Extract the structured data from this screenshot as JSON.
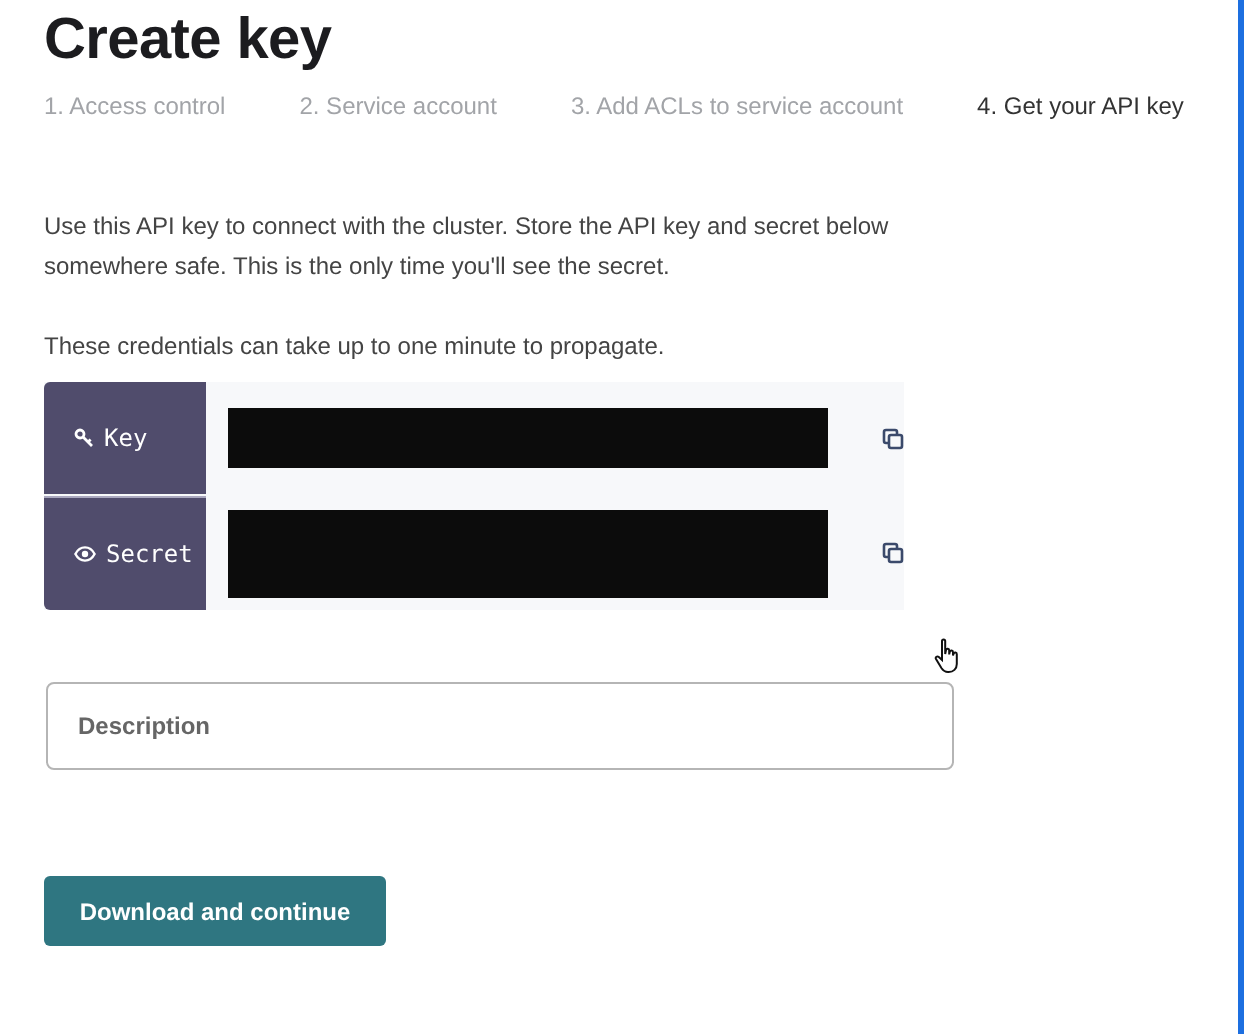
{
  "title": "Create key",
  "steps": [
    {
      "label": "1. Access control",
      "selected": false
    },
    {
      "label": "2. Service account",
      "selected": false
    },
    {
      "label": "3. Add ACLs to service account",
      "selected": false
    },
    {
      "label": "4. Get your API key",
      "selected": true
    }
  ],
  "intro": "Use this API key to connect with the cluster. Store the API key and secret below somewhere safe. This is the only time you'll see the secret.",
  "note": "These credentials can take up to one minute to propagate.",
  "credentials": [
    {
      "kind": "key",
      "label": "Key"
    },
    {
      "kind": "secret",
      "label": "Secret"
    }
  ],
  "description": {
    "placeholder": "Description"
  },
  "button": "Download and continue"
}
